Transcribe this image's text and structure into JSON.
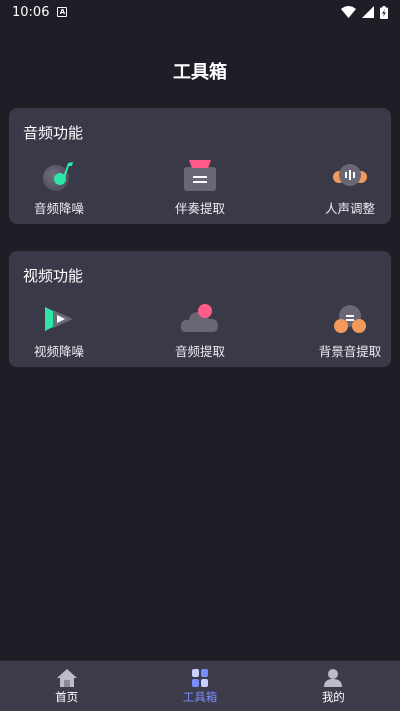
{
  "status_bar": {
    "time": "10:06",
    "notif_letter": "A"
  },
  "page": {
    "title": "工具箱"
  },
  "audio_section": {
    "title": "音频功能",
    "tools": [
      {
        "label": "音频降噪",
        "icon": "audio-denoise-icon"
      },
      {
        "label": "伴奏提取",
        "icon": "accompaniment-extract-icon"
      },
      {
        "label": "人声调整",
        "icon": "vocal-adjust-icon"
      }
    ]
  },
  "video_section": {
    "title": "视频功能",
    "tools": [
      {
        "label": "视频降噪",
        "icon": "video-denoise-icon"
      },
      {
        "label": "音频提取",
        "icon": "audio-extract-icon"
      },
      {
        "label": "背景音提取",
        "icon": "background-sound-extract-icon"
      }
    ]
  },
  "bottom_nav": {
    "items": [
      {
        "label": "首页",
        "icon": "home-icon",
        "active": false
      },
      {
        "label": "工具箱",
        "icon": "toolbox-icon",
        "active": true
      },
      {
        "label": "我的",
        "icon": "profile-icon",
        "active": false
      }
    ]
  },
  "colors": {
    "background": "#1f1e27",
    "card": "#3a3947",
    "nav_background": "#3d3c4a",
    "accent": "#7b8cff",
    "green": "#2ee6a8",
    "pink": "#ff5c8a",
    "orange": "#f39a5a"
  }
}
